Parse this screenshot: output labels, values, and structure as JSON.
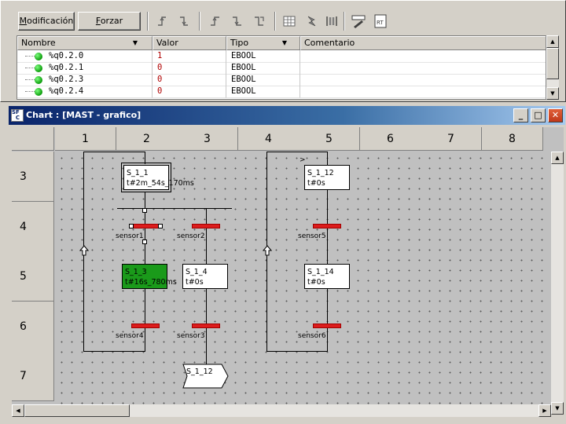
{
  "toolbar": {
    "modify_label": "Modificación",
    "force_label": "Forzar",
    "tools": [
      "rising-edge-icon",
      "falling-edge-icon",
      "force-rising-icon",
      "force-falling-icon",
      "force-falling-alt-icon",
      "table-icon",
      "lightning-icon",
      "columns-icon",
      "edit-pen-icon",
      "rt-icon"
    ]
  },
  "table": {
    "columns": [
      "Nombre",
      "Valor",
      "Tipo",
      "Comentario"
    ],
    "rows": [
      {
        "name": "%q0.2.0",
        "value": "1",
        "type": "EBOOL",
        "comment": ""
      },
      {
        "name": "%q0.2.1",
        "value": "0",
        "type": "EBOOL",
        "comment": ""
      },
      {
        "name": "%q0.2.3",
        "value": "0",
        "type": "EBOOL",
        "comment": ""
      },
      {
        "name": "%q0.2.4",
        "value": "0",
        "type": "EBOOL",
        "comment": ""
      }
    ]
  },
  "chart_window": {
    "title": "Chart : [MAST - grafico]",
    "column_headers": [
      "1",
      "2",
      "3",
      "4",
      "5",
      "6",
      "7",
      "8"
    ],
    "row_headers": [
      "3",
      "4",
      "5",
      "6",
      "7"
    ]
  },
  "sfc": {
    "steps": [
      {
        "id": "S_1_1",
        "time": "t#2m_54s_170ms",
        "state": "initial"
      },
      {
        "id": "S_1_3",
        "time": "t#16s_780ms",
        "state": "active"
      },
      {
        "id": "S_1_4",
        "time": "t#0s",
        "state": "inactive"
      },
      {
        "id": "S_1_12",
        "time": "t#0s",
        "state": "inactive"
      },
      {
        "id": "S_1_14",
        "time": "t#0s",
        "state": "inactive"
      }
    ],
    "transitions": [
      "sensor1",
      "sensor2",
      "sensor4",
      "sensor3",
      "sensor5",
      "sensor6"
    ],
    "jump_target": "S_1_12",
    "link_marker": ">",
    "colors": {
      "transition": "#dc1c1c",
      "active_step": "#1a9a1a",
      "status_ok": "#0a9a0a"
    }
  }
}
